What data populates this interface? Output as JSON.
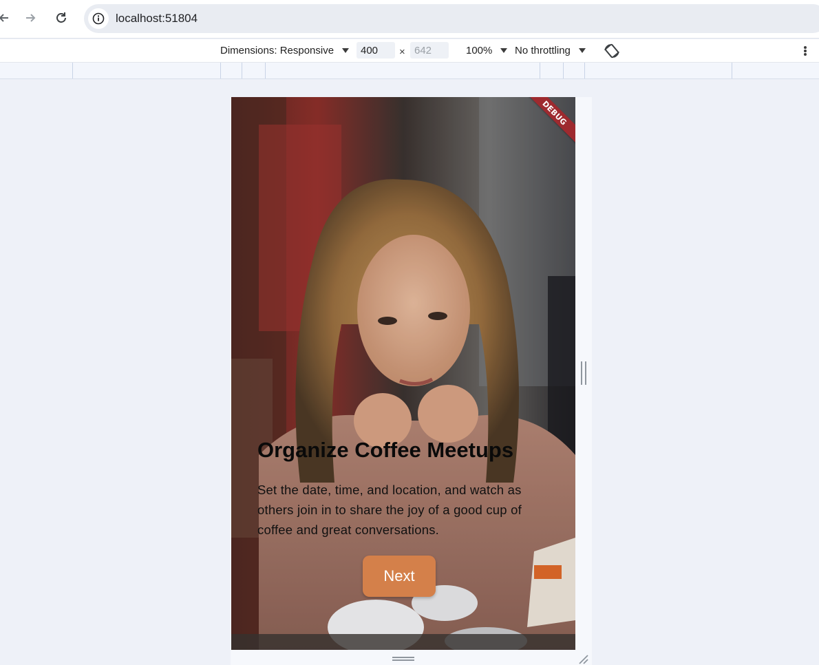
{
  "browser": {
    "url": "localhost:51804",
    "icons": {
      "back": "arrow-left-icon",
      "forward": "arrow-right-icon",
      "reload": "reload-icon",
      "site_info": "info-icon"
    }
  },
  "device_toolbar": {
    "dimensions_label": "Dimensions: Responsive",
    "width_value": "400",
    "height_placeholder": "642",
    "times": "×",
    "zoom_label": "100%",
    "throttling_label": "No throttling",
    "icons": {
      "rotate": "rotate-icon",
      "more": "kebab-menu-icon"
    }
  },
  "app": {
    "debug_banner": "DEBUG",
    "headline": "Organize Coffee Meetups",
    "body": "Set the date, time, and location, and watch as others join in to share the joy of a good cup of coffee and great conversations.",
    "next_label": "Next",
    "colors": {
      "button": "#d4804a",
      "debug": "#9e2a2f"
    }
  }
}
